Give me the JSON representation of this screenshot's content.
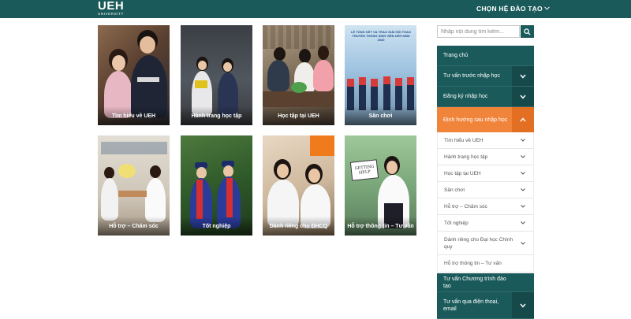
{
  "header": {
    "logo_main": "UEH",
    "logo_sub": "UNIVERSITY",
    "program_menu_label": "CHỌN HỆ ĐÀO TẠO"
  },
  "cards": [
    {
      "label": "Tìm hiểu về UEH"
    },
    {
      "label": "Hành trang học tập"
    },
    {
      "label": "Học tập tại UEH"
    },
    {
      "label": "Sân chơi"
    },
    {
      "label": "Hỗ trợ – Chăm sóc"
    },
    {
      "label": "Tốt nghiệp"
    },
    {
      "label": "Dành riêng cho ĐHCQ"
    },
    {
      "label": "Hỗ trợ thông tin – Tư vấn"
    }
  ],
  "search": {
    "placeholder": "Nhập nội dung tìm kiếm...",
    "value": ""
  },
  "sidebar": {
    "items": [
      {
        "label": "Trang chủ"
      },
      {
        "label": "Tư vấn trước nhập học"
      },
      {
        "label": "Đăng ký nhập học"
      },
      {
        "label": "Định hướng sau nhập học"
      },
      {
        "label": "Tư vấn Chương trình đào tạo"
      },
      {
        "label": "Tư vấn qua điện thoại, email"
      }
    ],
    "sub_items": [
      {
        "label": "Tìm hiểu về UEH"
      },
      {
        "label": "Hành trang học tập"
      },
      {
        "label": "Học tập tại UEH"
      },
      {
        "label": "Sân chơi"
      },
      {
        "label": "Hỗ trợ – Chăm sóc"
      },
      {
        "label": "Tốt nghiệp"
      },
      {
        "label": "Dành riêng cho Đại học Chính quy"
      },
      {
        "label": "Hỗ trợ thông tin – Tư vấn"
      }
    ]
  },
  "card_images": {
    "poster_title": "LỄ TỔNG KẾT VÀ TRAO GIẢI HỘI THAO TRUYỀN THỐNG SINH VIÊN UEH NĂM 2020",
    "sign_text": "GETTING HELP"
  },
  "colors": {
    "brand_teal": "#1b5a5a",
    "accent_orange": "#f0843b"
  }
}
